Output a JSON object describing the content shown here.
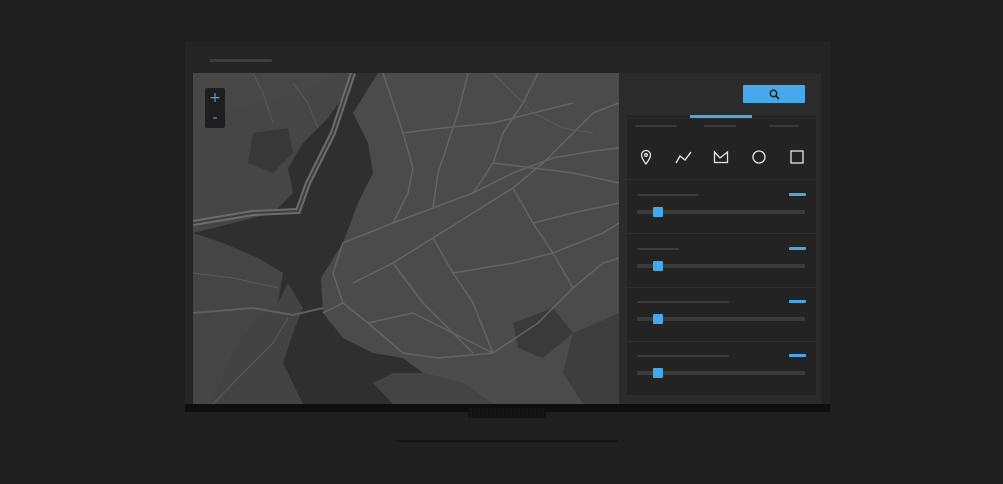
{
  "colors": {
    "accent": "#44a8ea",
    "background": "#1f1f1f",
    "map_land": "#4a4a4a",
    "map_water": "#2f2f2f",
    "map_road": "#6a6a6a",
    "panel": "#2b2b2b",
    "card": "#232323"
  },
  "map": {
    "zoom_in_label": "+",
    "zoom_out_label": "-"
  },
  "panel": {
    "search_icon": "search-icon",
    "tabs": [
      {
        "name": "tab-1",
        "active": false
      },
      {
        "name": "tab-2",
        "active": true
      },
      {
        "name": "tab-3",
        "active": false
      }
    ],
    "tools": [
      {
        "name": "marker-tool",
        "icon": "map-pin-icon"
      },
      {
        "name": "line-tool",
        "icon": "polyline-icon"
      },
      {
        "name": "polygon-tool",
        "icon": "polygon-icon"
      },
      {
        "name": "circle-tool",
        "icon": "circle-icon"
      },
      {
        "name": "rectangle-tool",
        "icon": "square-icon"
      }
    ],
    "sliders": [
      {
        "name": "slider-1",
        "value": 0.1
      },
      {
        "name": "slider-2",
        "value": 0.1
      },
      {
        "name": "slider-3",
        "value": 0.1
      },
      {
        "name": "slider-4",
        "value": 0.1
      }
    ]
  }
}
